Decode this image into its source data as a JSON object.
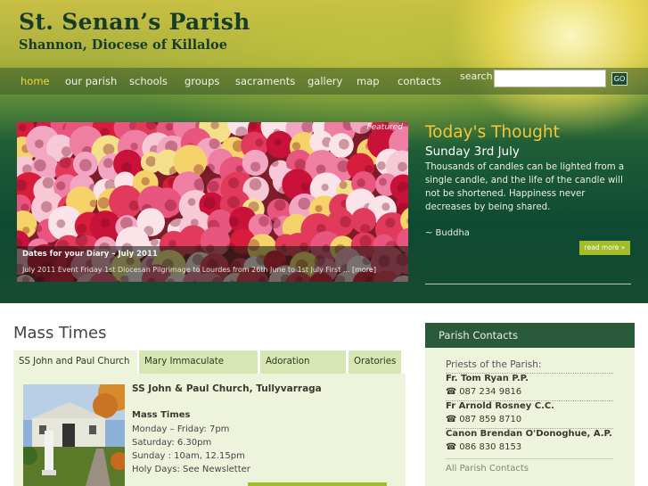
{
  "site": {
    "title": "St. Senan’s Parish",
    "subtitle": "Shannon, Diocese of Killaloe"
  },
  "nav": {
    "items": [
      {
        "label": "home",
        "active": true
      },
      {
        "label": "our parish"
      },
      {
        "label": "schools"
      },
      {
        "label": "groups"
      },
      {
        "label": "sacraments"
      },
      {
        "label": "gallery"
      },
      {
        "label": "map"
      },
      {
        "label": "contacts"
      }
    ],
    "search_label": "search:",
    "search_value": "",
    "search_button": "GO"
  },
  "featured": {
    "tag": "Featured",
    "title": "Dates for your Diary – July 2011",
    "text": "July 2011 Event Friday 1st Diocesan Pilgrimage to Lourdes from 26th June to 1st July First ...",
    "more": "[more]"
  },
  "thought": {
    "heading": "Today's Thought",
    "date": "Sunday 3rd July",
    "text": "Thousands of candles can be lighted from a single candle, and the life of the candle will not be shortened. Happiness never decreases by being shared.",
    "author": "~ Buddha",
    "read_more": "read more »"
  },
  "mass": {
    "title": "Mass Times",
    "tabs": [
      "SS John and Paul Church",
      "Mary Immaculate Church",
      "Adoration Chapel",
      "Oratories"
    ],
    "church": "SS John & Paul Church, Tullyvarraga",
    "heading": "Mass Times",
    "lines": [
      "Monday – Friday: 7pm",
      "Saturday: 6.30pm",
      "Sunday : 10am, 12.15pm",
      "Holy Days: See Newsletter"
    ]
  },
  "contacts": {
    "heading": "Parish Contacts",
    "label": "Priests of the Parish:",
    "people": [
      {
        "name": "Fr. Tom Ryan P.P.",
        "phone": "087 234 9816"
      },
      {
        "name": "Fr Arnold Rosney C.C.",
        "phone": "087 859 8710"
      },
      {
        "name": "Canon Brendan O'Donoghue, A.P.",
        "phone": "086 830 8153"
      }
    ],
    "all_link": "All Parish Contacts",
    "phone_icon": "telephone-icon"
  }
}
